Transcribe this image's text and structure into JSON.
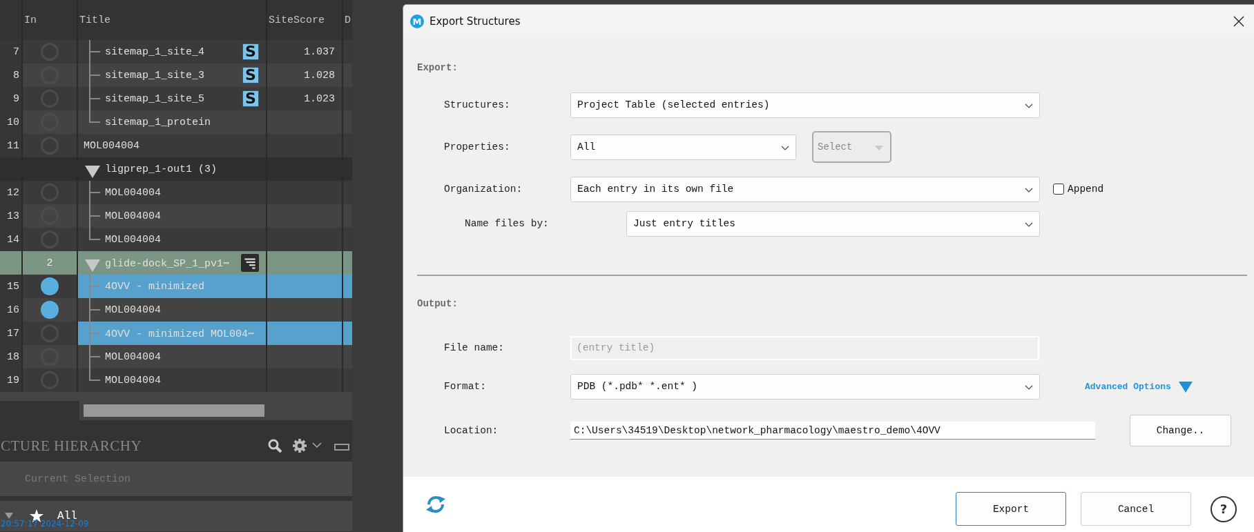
{
  "project_table": {
    "columns": [
      "In",
      "Title",
      "SiteScore",
      "D"
    ],
    "rows": [
      {
        "kind": "group",
        "children": [
          {
            "kind": "entry",
            "row": "7",
            "included": false,
            "selected": false,
            "title": "sitemap_1_site_4",
            "badge": "S",
            "site_score": "1.037"
          },
          {
            "kind": "entry",
            "row": "8",
            "included": false,
            "selected": false,
            "title": "sitemap_1_site_3",
            "badge": "S",
            "site_score": "1.028"
          },
          {
            "kind": "entry",
            "row": "9",
            "included": false,
            "selected": false,
            "title": "sitemap_1_site_5",
            "badge": "S",
            "site_score": "1.023"
          },
          {
            "kind": "entry",
            "row": "10",
            "included": false,
            "selected": false,
            "title": "sitemap_1_protein"
          }
        ]
      },
      {
        "kind": "entry",
        "row": "11",
        "included": false,
        "selected": false,
        "title": "MOL004004"
      },
      {
        "kind": "group",
        "title": "ligprep_1-out1 (3)",
        "expanded": true,
        "selected": false,
        "children": [
          {
            "kind": "entry",
            "row": "12",
            "included": false,
            "selected": false,
            "title": "MOL004004"
          },
          {
            "kind": "entry",
            "row": "13",
            "included": false,
            "selected": false,
            "title": "MOL004004"
          },
          {
            "kind": "entry",
            "row": "14",
            "included": false,
            "selected": false,
            "title": "MOL004004"
          }
        ]
      },
      {
        "kind": "group",
        "title": "glide-dock_SP_1_pv1⋯",
        "count": "2",
        "expanded": true,
        "selected": true,
        "children": [
          {
            "kind": "entry",
            "row": "15",
            "included": true,
            "selected": true,
            "title": "4OVV - minimized"
          },
          {
            "kind": "entry",
            "row": "16",
            "included": true,
            "selected": false,
            "title": "MOL004004"
          },
          {
            "kind": "entry",
            "row": "17",
            "included": false,
            "selected": true,
            "title": "4OVV - minimized MOL004⋯"
          },
          {
            "kind": "entry",
            "row": "18",
            "included": false,
            "selected": false,
            "title": "MOL004004"
          },
          {
            "kind": "entry",
            "row": "19",
            "included": false,
            "selected": false,
            "title": "MOL004004"
          }
        ]
      }
    ]
  },
  "hierarchy_panel": {
    "title": "CTURE HIERARCHY",
    "filter": {
      "placeholder": "Current Selection"
    },
    "items": [
      {
        "label": "All",
        "expanded": true
      }
    ]
  },
  "timestamp": "20:57:17 2024-12-09",
  "dialog": {
    "logo": "M",
    "title": "Export Structures",
    "export": {
      "heading": "Export:",
      "structures": {
        "label": "Structures:",
        "value": "Project Table (selected entries)"
      },
      "properties": {
        "label": "Properties:",
        "value": "All",
        "select_button": {
          "label": "Select",
          "disabled": true
        }
      },
      "organization": {
        "label": "Organization:",
        "value": "Each entry in its own file",
        "append": {
          "label": "Append",
          "checked": false
        }
      },
      "name_files_by": {
        "label": "Name files by:",
        "value": "Just entry titles"
      }
    },
    "output": {
      "heading": "Output:",
      "file_name": {
        "label": "File name:",
        "placeholder": "(entry title)",
        "disabled": true
      },
      "format": {
        "label": "Format:",
        "value": "PDB (*.pdb* *.ent* )"
      },
      "advanced_options": "Advanced Options",
      "location": {
        "label": "Location:",
        "value": "C:\\Users\\34519\\Desktop\\network_pharmacology\\maestro_demo\\4OVV"
      },
      "change_button": "Change.."
    },
    "buttons": [
      {
        "label": "Export",
        "default": true
      },
      {
        "label": "Cancel",
        "default": false
      }
    ],
    "help": "?"
  }
}
